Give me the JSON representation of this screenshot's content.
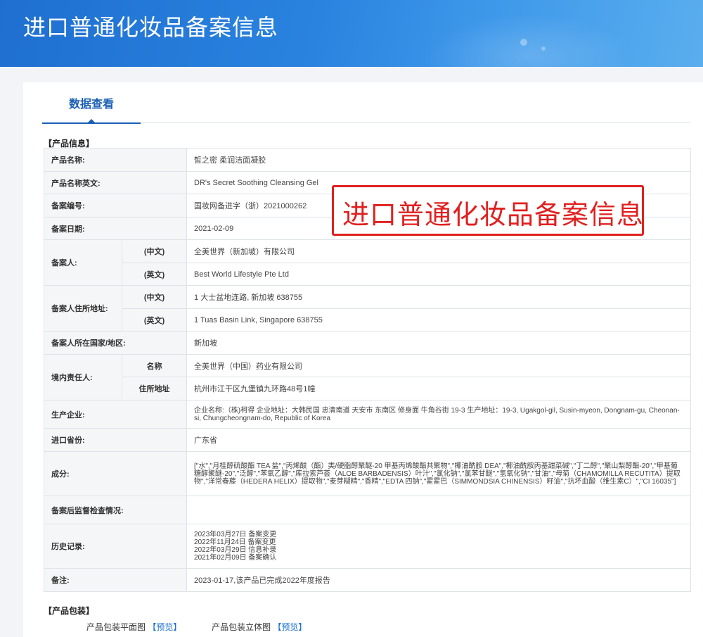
{
  "header": {
    "title": "进口普通化妆品备案信息"
  },
  "tabs": [
    {
      "label": "数据查看",
      "active": true
    }
  ],
  "product_section": {
    "title": "【产品信息】"
  },
  "rows": {
    "name": {
      "label": "产品名称:",
      "value": "皙之密 柔润洁面凝胶"
    },
    "name_en": {
      "label": "产品名称英文:",
      "value": "DR's Secret Soothing Cleansing Gel"
    },
    "reg_no": {
      "label": "备案编号:",
      "value": "国妆网备进字（浙）2021000262"
    },
    "reg_date": {
      "label": "备案日期:",
      "value": "2021-02-09"
    },
    "registrant": {
      "label": "备案人:",
      "cn_label": "(中文)",
      "cn_value": "全美世界（新加坡）有限公司",
      "en_label": "(英文)",
      "en_value": "Best World Lifestyle Pte Ltd"
    },
    "address": {
      "label": "备案人住所地址:",
      "cn_label": "(中文)",
      "cn_value": "1 大士盆地连路, 新加坡 638755",
      "en_label": "(英文)",
      "en_value": "1 Tuas Basin Link, Singapore 638755"
    },
    "country": {
      "label": "备案人所在国家/地区:",
      "value": "新加坡"
    },
    "domestic": {
      "label": "境内责任人:",
      "name_label": "名称",
      "name_value": "全美世界（中国）药业有限公司",
      "addr_label": "住所地址",
      "addr_value": "杭州市江干区九堡镇九环路48号1幢"
    },
    "manufacturer": {
      "label": "生产企业:",
      "value": "企业名称:（株)柯得 企业地址：大韩民国 忠清南道 天安市 东南区 修身面 牛角谷街 19-3 生产地址：19-3, Ugakgol-gil, Susin-myeon, Dongnam-gu, Cheonan-si, Chungcheongnam-do, Republic of Korea"
    },
    "province": {
      "label": "进口省份:",
      "value": "广东省"
    },
    "ingredients": {
      "label": "成分:",
      "value": "[\"水\",\"月桂醇硫酸酯 TEA 盐\",\"丙烯酸（酯）类/硬脂醇聚醚-20 甲基丙烯酸酯共聚物\",\"椰油酰胺 DEA\",\"椰油酰胺丙基甜菜碱\",\"丁二醇\",\"聚山梨醇酯-20\",\"甲基葡糖醇聚醚-20\",\"泛醇\",\"苯氧乙醇\",\"库拉索芦荟（ALOE BARBADENSIS）叶汁\",\"氯化钠\",\"氯苯甘醚\",\"氢氧化钠\",\"甘油\",\"母菊（CHAMOMILLA RECUTITA）提取物\",\"洋常春藤（HEDERA HELIX）提取物\",\"麦芽糊精\",\"香精\",\"EDTA 四钠\",\"霍霍巴（SIMMONDSIA CHINENSIS）籽油\",\"抗坏血酸（维生素C）\",\"CI 16035\"]"
    },
    "inspection": {
      "label": "备案后监督检查情况:",
      "value": ""
    },
    "history": {
      "label": "历史记录:",
      "entries": [
        "2023年03月27日 备案变更",
        "2022年11月24日 备案变更",
        "2022年03月29日 信息补录",
        "2021年02月09日 备案确认"
      ]
    },
    "remark": {
      "label": "备注:",
      "value": "2023-01-17,该产品已完成2022年度报告"
    }
  },
  "overlay": {
    "text": "进口普通化妆品备案信息",
    "color": "#e02020"
  },
  "package_section": {
    "title": "【产品包装】",
    "flat_label": "产品包装平面图",
    "flat_link": "【预览】",
    "solid_label": "产品包装立体图",
    "solid_link": "【预览】"
  },
  "colors": {
    "banner": "#2a83df",
    "accent": "#1a5fb4",
    "link": "#1a6fd0",
    "overlay": "#e02020"
  }
}
